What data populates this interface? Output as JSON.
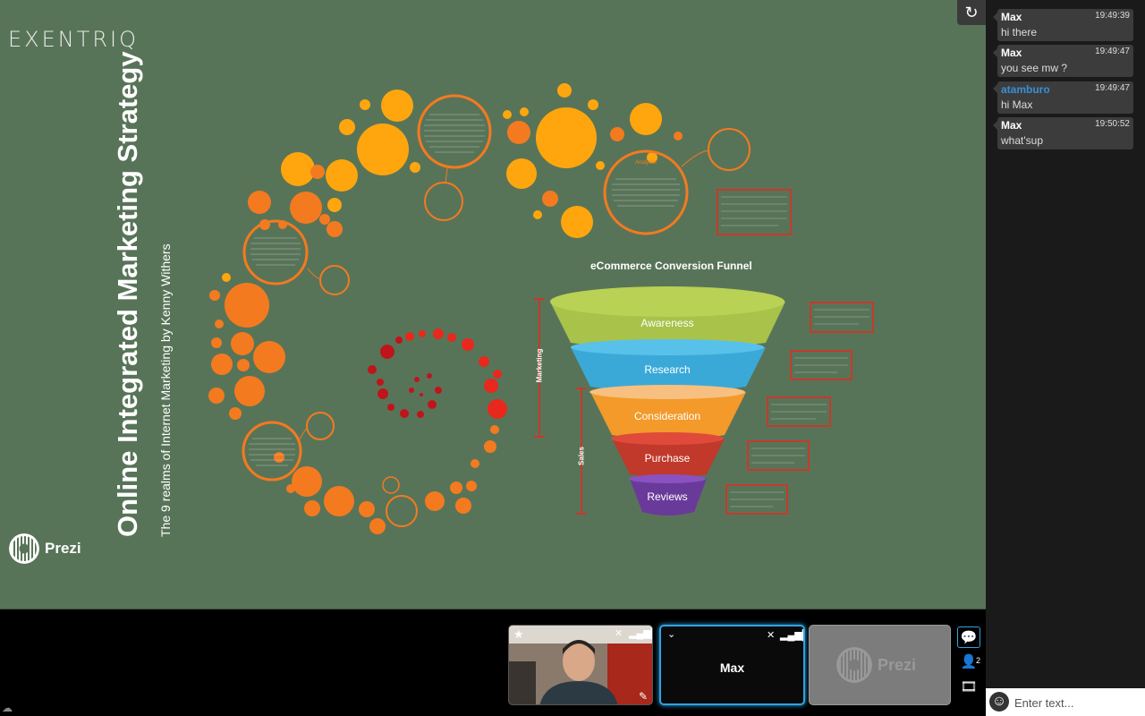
{
  "presentation": {
    "brand": "Exentriq",
    "title": "Online Integrated Marketing Strategy",
    "subtitle": "The 9 realms of Internet Marketing by Kenny Withers",
    "prezi_logo": "Prezi",
    "funnel": {
      "title": "eCommerce Conversion Funnel",
      "stages": [
        "Awareness",
        "Research",
        "Consideration",
        "Purchase",
        "Reviews"
      ],
      "side_labels": [
        "Marketing",
        "Sales"
      ]
    },
    "bubble_labels": [
      "Analytics"
    ]
  },
  "chat": {
    "messages": [
      {
        "name": "Max",
        "time": "19:49:39",
        "text": "hi there"
      },
      {
        "name": "Max",
        "time": "19:49:47",
        "text": "you see mw ?"
      },
      {
        "name": "atamburo",
        "time": "19:49:47",
        "text": "hi Max"
      },
      {
        "name": "Max",
        "time": "19:50:52",
        "text": "what'sup"
      }
    ],
    "input_placeholder": "Enter text..."
  },
  "video": {
    "participant_name": "Max",
    "prezi_tile_label": "Prezi",
    "participant_count": "2"
  },
  "icons": [
    "refresh-icon",
    "smiley-icon",
    "cloud-icon",
    "chat-icon",
    "participants-icon",
    "film-icon",
    "mute-icon",
    "signal-icon",
    "star-icon",
    "pencil-icon",
    "chevron-down-icon"
  ],
  "colors": {
    "stage_bg": "#587458",
    "accent_blue": "#2fa3e0",
    "orange": "#f47a1f",
    "yellow": "#ffa60e",
    "red": "#d9261c"
  }
}
